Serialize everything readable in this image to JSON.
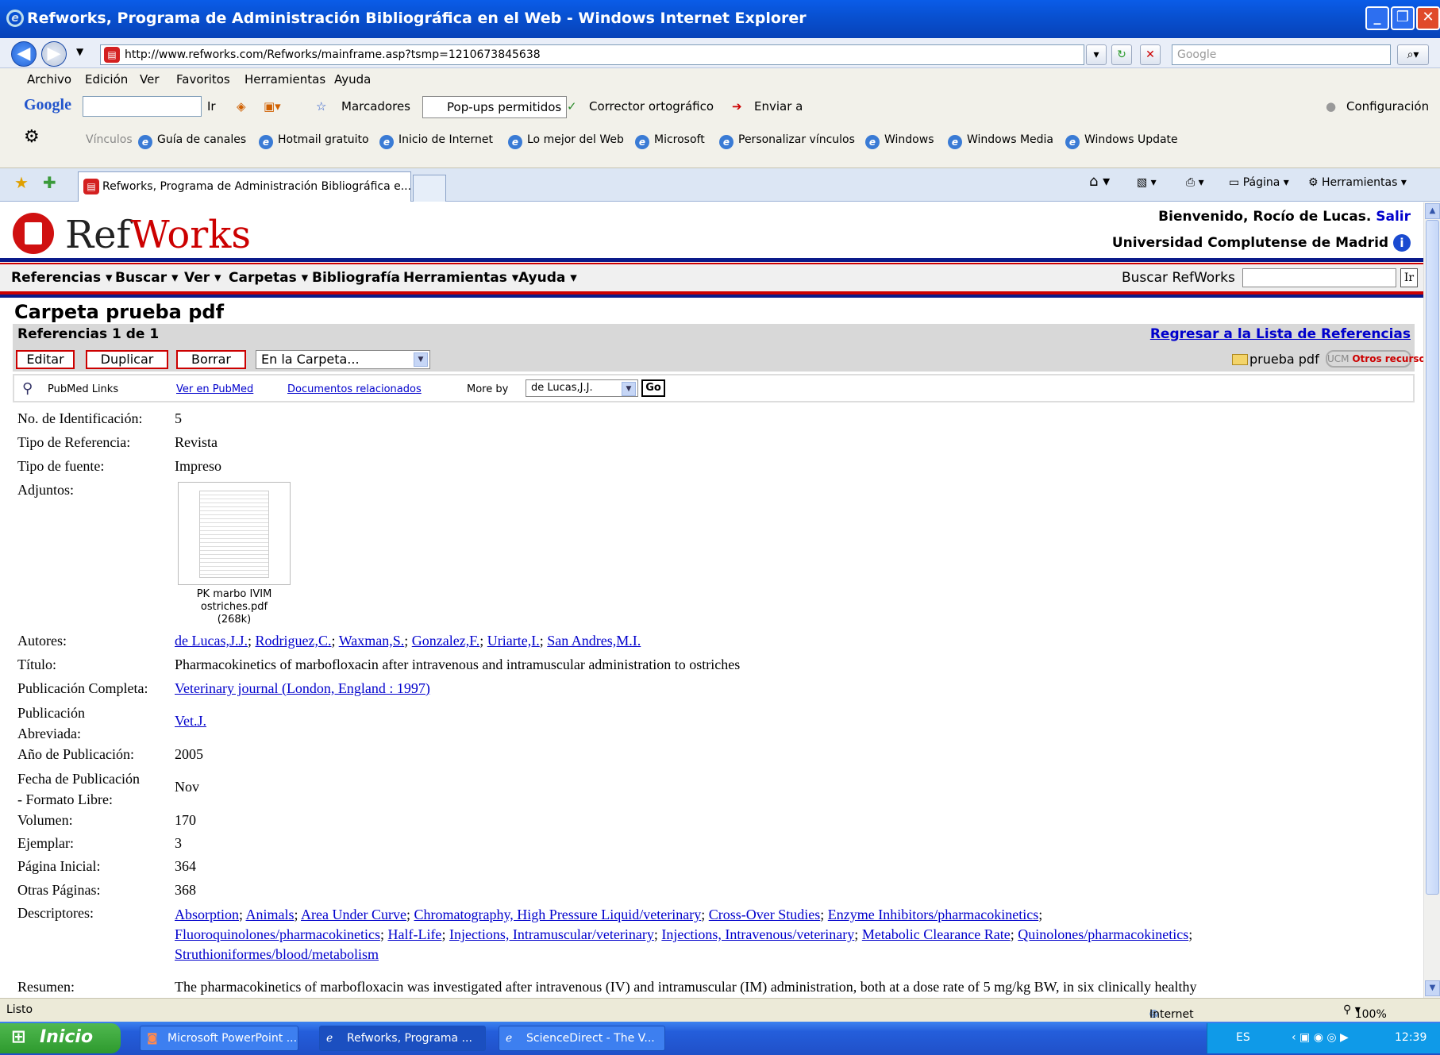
{
  "window": {
    "title": "Refworks, Programa de Administración Bibliográfica en el Web - Windows Internet Explorer"
  },
  "address": {
    "url": "http://www.refworks.com/Refworks/mainframe.asp?tsmp=1210673845638",
    "search_placeholder": "Google"
  },
  "menu": [
    "Archivo",
    "Edición",
    "Ver",
    "Favoritos",
    "Herramientas",
    "Ayuda"
  ],
  "gtoolbar": {
    "ir": "Ir",
    "marcadores": "Marcadores",
    "popups": "Pop-ups permitidos",
    "corrector": "Corrector ortográfico",
    "enviar": "Enviar a",
    "config": "Configuración"
  },
  "links": {
    "label": "Vínculos",
    "items": [
      "Guía de canales",
      "Hotmail gratuito",
      "Inicio de Internet",
      "Lo mejor del Web",
      "Microsoft",
      "Personalizar vínculos",
      "Windows",
      "Windows Media",
      "Windows Update"
    ]
  },
  "tabs": {
    "active": "Refworks, Programa de Administración Bibliográfica e...",
    "pagina": "Página",
    "herramientas": "Herramientas"
  },
  "refworks": {
    "logo_a": "Ref",
    "logo_b": "Works",
    "welcome": "Bienvenido, Rocío de Lucas.",
    "salir": "Salir",
    "institution": "Universidad Complutense de Madrid",
    "nav": [
      "Referencias",
      "Buscar",
      "Ver",
      "Carpetas",
      "Bibliografía",
      "Herramientas",
      "Ayuda"
    ],
    "search_label": "Buscar RefWorks",
    "search_go": "Ir",
    "folder_title": "Carpeta prueba pdf",
    "refcount": "Referencias 1 de 1",
    "back_link": "Regresar a la Lista de Referencias",
    "buttons": {
      "edit": "Editar",
      "dup": "Duplicar",
      "del": "Borrar"
    },
    "carpeta_select": "En la Carpeta...",
    "folder_label": "prueba pdf",
    "ucm_a": "UCM",
    "ucm_b": "Otros recursos",
    "pubmed": {
      "label": "PubMed Links",
      "ver": "Ver en PubMed",
      "docs": "Documentos relacionados",
      "moreby": "More by",
      "author": "de Lucas,J.J.",
      "go": "Go"
    }
  },
  "record": {
    "id": {
      "label": "No. de Identificación:",
      "value": "5"
    },
    "tipo_ref": {
      "label": "Tipo de Referencia:",
      "value": "Revista"
    },
    "tipo_fuente": {
      "label": "Tipo de fuente:",
      "value": "Impreso"
    },
    "adjuntos": {
      "label": "Adjuntos:",
      "file": "PK marbo IVIM ostriches.pdf",
      "size": "(268k)"
    },
    "autores": {
      "label": "Autores:",
      "values": [
        "de Lucas,J.J.",
        "Rodriguez,C.",
        "Waxman,S.",
        "Gonzalez,F.",
        "Uriarte,I.",
        "San Andres,M.I."
      ]
    },
    "titulo": {
      "label": "Título:",
      "value": "Pharmacokinetics of marbofloxacin after intravenous and intramuscular administration to ostriches"
    },
    "pub_completa": {
      "label": "Publicación Completa:",
      "value": "Veterinary journal (London, England : 1997)"
    },
    "pub_abrev": {
      "label_1": "Publicación",
      "label_2": "Abreviada:",
      "value": "Vet.J."
    },
    "anio": {
      "label": "Año de Publicación:",
      "value": "2005"
    },
    "fecha": {
      "label_1": "Fecha de Publicación",
      "label_2": "- Formato Libre:",
      "value": "Nov"
    },
    "volumen": {
      "label": "Volumen:",
      "value": "170"
    },
    "ejemplar": {
      "label": "Ejemplar:",
      "value": "3"
    },
    "pag_ini": {
      "label": "Página Inicial:",
      "value": "364"
    },
    "otras_pag": {
      "label": "Otras Páginas:",
      "value": "368"
    },
    "descriptores": {
      "label": "Descriptores:",
      "line1": [
        "Absorption",
        "Animals",
        "Area Under Curve",
        "Chromatography, High Pressure Liquid/veterinary",
        "Cross-Over Studies",
        "Enzyme Inhibitors/pharmacokinetics"
      ],
      "line2": [
        "Fluoroquinolones/pharmacokinetics",
        "Half-Life",
        "Injections, Intramuscular/veterinary",
        "Injections, Intravenous/veterinary",
        "Metabolic Clearance Rate",
        "Quinolones/pharmacokinetics"
      ],
      "line3": [
        "Struthioniformes/blood/metabolism"
      ]
    },
    "resumen": {
      "label": "Resumen:",
      "value": "The pharmacokinetics of marbofloxacin was investigated after intravenous (IV) and intramuscular (IM) administration, both at a dose rate of 5 mg/kg BW, in six clinically healthy"
    }
  },
  "status": {
    "left": "Listo",
    "zone": "Internet",
    "zoom": "100%"
  },
  "taskbar": {
    "start": "Inicio",
    "tasks": [
      "Microsoft PowerPoint ...",
      "Refworks, Programa ...",
      "ScienceDirect - The V..."
    ],
    "lang": "ES",
    "clock": "12:39"
  }
}
